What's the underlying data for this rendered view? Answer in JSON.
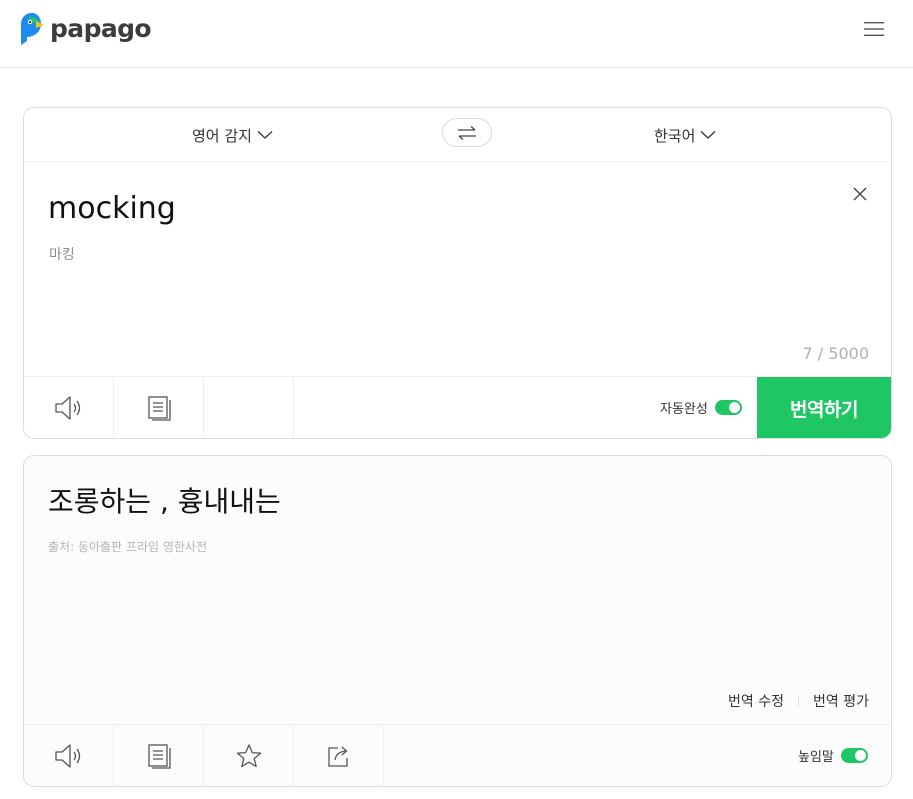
{
  "header": {
    "logo_text": "papago",
    "menu_icon": "hamburger-menu-icon"
  },
  "source": {
    "language": "영어 감지",
    "text": "mocking",
    "pronunciation": "마킹",
    "char_count": "7 / 5000",
    "autocomplete_label": "자동완성",
    "autocomplete_on": true,
    "translate_button": "번역하기"
  },
  "swap_icon": "swap-arrows-icon",
  "target": {
    "language": "한국어",
    "text": "조롱하는 , 흉내내는",
    "source_note": "출처: 동아출판 프라임 영한사전",
    "edit_link": "번역 수정",
    "rate_link": "번역 평가",
    "honorific_label": "높임말",
    "honorific_on": true
  },
  "colors": {
    "accent": "#1ec764",
    "logo_blue": "#1f8bf0",
    "logo_yellow": "#f6c21a"
  }
}
